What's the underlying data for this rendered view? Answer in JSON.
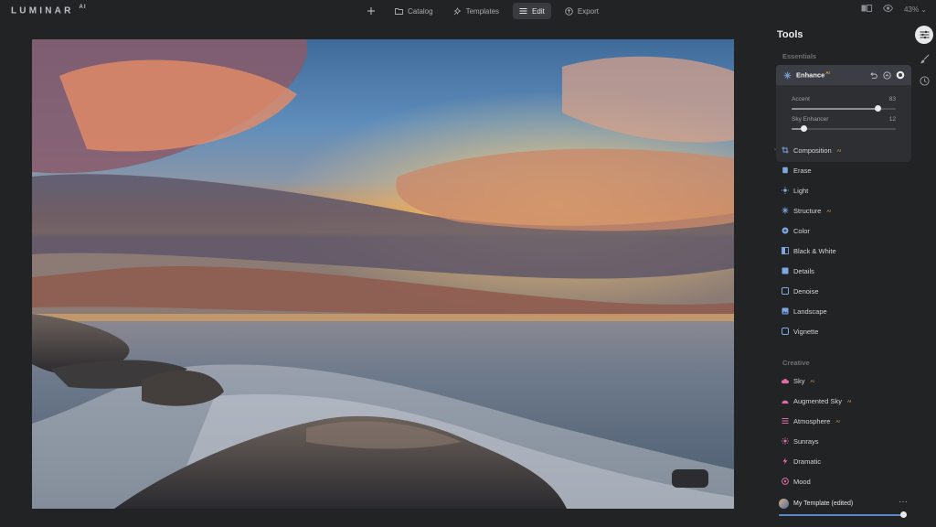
{
  "app": {
    "logo": "LUMINAR",
    "logo_sup": "AI"
  },
  "nav": {
    "items": [
      {
        "label": "Catalog",
        "icon": "folder-icon"
      },
      {
        "label": "Templates",
        "icon": "templates-icon"
      },
      {
        "label": "Edit",
        "icon": "sliders-icon"
      },
      {
        "label": "Export",
        "icon": "export-icon"
      }
    ],
    "active": "Edit"
  },
  "topright": {
    "zoom": "43%"
  },
  "sidebar": {
    "title": "Tools",
    "essentials_label": "Essentials",
    "creative_label": "Creative",
    "enhance": {
      "label": "Enhance",
      "sliders": [
        {
          "label": "Accent",
          "value": "83",
          "fraction": 0.83
        },
        {
          "label": "Sky Enhancer",
          "value": "12",
          "fraction": 0.12
        }
      ]
    },
    "essentials": [
      {
        "label": "Composition",
        "icon": "crop-icon",
        "ai": true
      },
      {
        "label": "Erase",
        "icon": "eraser-icon",
        "ai": false
      },
      {
        "label": "Light",
        "icon": "sun-icon",
        "ai": false
      },
      {
        "label": "Structure",
        "icon": "structure-icon",
        "ai": true
      },
      {
        "label": "Color",
        "icon": "color-icon",
        "ai": false
      },
      {
        "label": "Black & White",
        "icon": "bw-icon",
        "ai": false
      },
      {
        "label": "Details",
        "icon": "details-icon",
        "ai": false
      },
      {
        "label": "Denoise",
        "icon": "denoise-icon",
        "ai": false
      },
      {
        "label": "Landscape",
        "icon": "landscape-icon",
        "ai": false
      },
      {
        "label": "Vignette",
        "icon": "vignette-icon",
        "ai": false
      }
    ],
    "creative": [
      {
        "label": "Sky",
        "icon": "cloud-icon",
        "ai": true
      },
      {
        "label": "Augmented Sky",
        "icon": "augmented-sky-icon",
        "ai": true
      },
      {
        "label": "Atmosphere",
        "icon": "atmosphere-icon",
        "ai": true
      },
      {
        "label": "Sunrays",
        "icon": "sunrays-icon",
        "ai": false
      },
      {
        "label": "Dramatic",
        "icon": "dramatic-icon",
        "ai": false
      },
      {
        "label": "Mood",
        "icon": "mood-icon",
        "ai": false
      }
    ],
    "ai_badge": "AI",
    "template": {
      "name": "My Template (edited)",
      "more": "···",
      "fraction": 1.0
    }
  }
}
